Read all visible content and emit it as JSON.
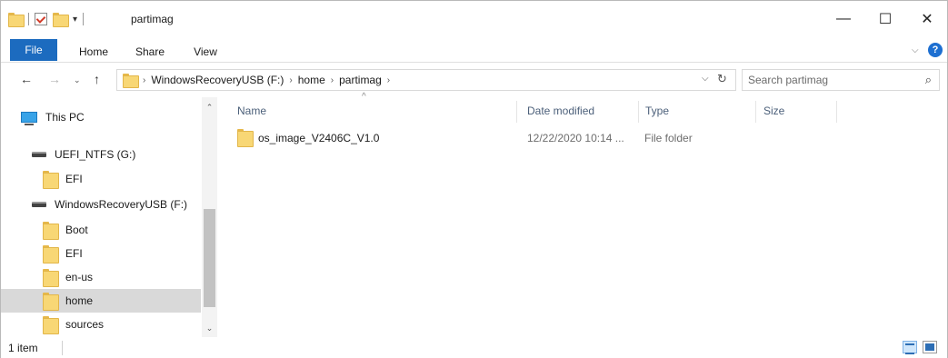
{
  "window": {
    "title": "partimag",
    "controls": {
      "minimize": "—",
      "maximize": "☐",
      "close": "✕"
    }
  },
  "quick_access": {
    "dropdown": "▾"
  },
  "ribbon": {
    "tabs": [
      "File",
      "Home",
      "Share",
      "View"
    ],
    "expand": "⌵",
    "help": "?"
  },
  "nav_buttons": {
    "back": "←",
    "forward": "→",
    "recent": "⌄",
    "up": "↑"
  },
  "address": {
    "crumbs": [
      "WindowsRecoveryUSB (F:)",
      "home",
      "partimag"
    ],
    "separator": "›",
    "dropdown": "⌵",
    "refresh": "↻"
  },
  "search": {
    "placeholder": "Search partimag",
    "icon": "⌕"
  },
  "navigation_pane": {
    "items": [
      {
        "label": "This PC",
        "icon": "pc-icon"
      },
      {
        "label": "UEFI_NTFS (G:)",
        "icon": "drive-icon"
      },
      {
        "label": "EFI",
        "icon": "folder-icon"
      },
      {
        "label": "WindowsRecoveryUSB (F:)",
        "icon": "drive-icon"
      },
      {
        "label": "Boot",
        "icon": "folder-icon"
      },
      {
        "label": "EFI",
        "icon": "folder-icon"
      },
      {
        "label": "en-us",
        "icon": "folder-icon"
      },
      {
        "label": "home",
        "icon": "folder-icon",
        "selected": true
      },
      {
        "label": "sources",
        "icon": "folder-icon"
      }
    ],
    "scroll_up": "⌃",
    "scroll_down": "⌄"
  },
  "file_list": {
    "columns": [
      "Name",
      "Date modified",
      "Type",
      "Size"
    ],
    "sort_indicator": "^",
    "rows": [
      {
        "name": "os_image_V2406C_V1.0",
        "date_modified": "12/22/2020 10:14 ...",
        "type": "File folder",
        "size": ""
      }
    ]
  },
  "status_bar": {
    "item_count": "1 item"
  },
  "colors": {
    "accent": "#1c6bbf",
    "selection": "#d9d9d9",
    "folder": "#f8d775",
    "header_text": "#4c607a"
  }
}
